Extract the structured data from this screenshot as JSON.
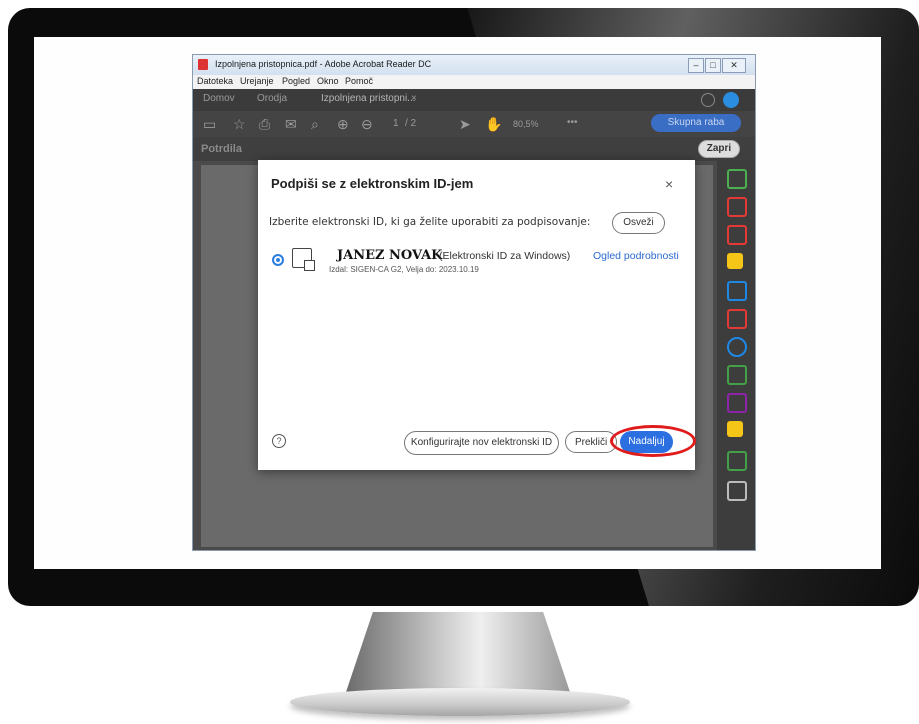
{
  "window": {
    "title": "Izpolnjena pristopnica.pdf - Adobe Acrobat Reader DC",
    "controls": [
      "–",
      "□",
      "✕"
    ]
  },
  "menu": [
    "Datoteka",
    "Urejanje",
    "Pogled",
    "Okno",
    "Pomoč"
  ],
  "tabs": {
    "home": "Domov",
    "tools": "Orodja",
    "document": "Izpolnjena pristopni...",
    "document_close": "×"
  },
  "toolbar": {
    "page_current": "1",
    "page_total": "/ 2",
    "zoom": "80,5%",
    "share_label": "Skupna raba"
  },
  "cert_bar": {
    "label": "Potrdila",
    "close_label": "Zapri"
  },
  "dialog": {
    "title": "Podpiši se z elektronskim ID-jem",
    "close_glyph": "×",
    "instruction": "Izberite elektronski ID, ki ga želite uporabiti za podpisovanje:",
    "refresh_label": "Osveži",
    "id": {
      "name": "JANEZ NOVAK",
      "type": "(Elektronski ID za Windows)",
      "details_link": "Ogled podrobnosti",
      "issuer": "Izdal: SIGEN-CA G2, Velja do: 2023.10.19"
    },
    "help_glyph": "?",
    "configure_label": "Konfigurirajte nov elektronski ID",
    "cancel_label": "Prekliči",
    "continue_label": "Nadaljuj"
  },
  "colors": {
    "accent": "#2b6fe0",
    "highlight": "#e01b1b"
  }
}
